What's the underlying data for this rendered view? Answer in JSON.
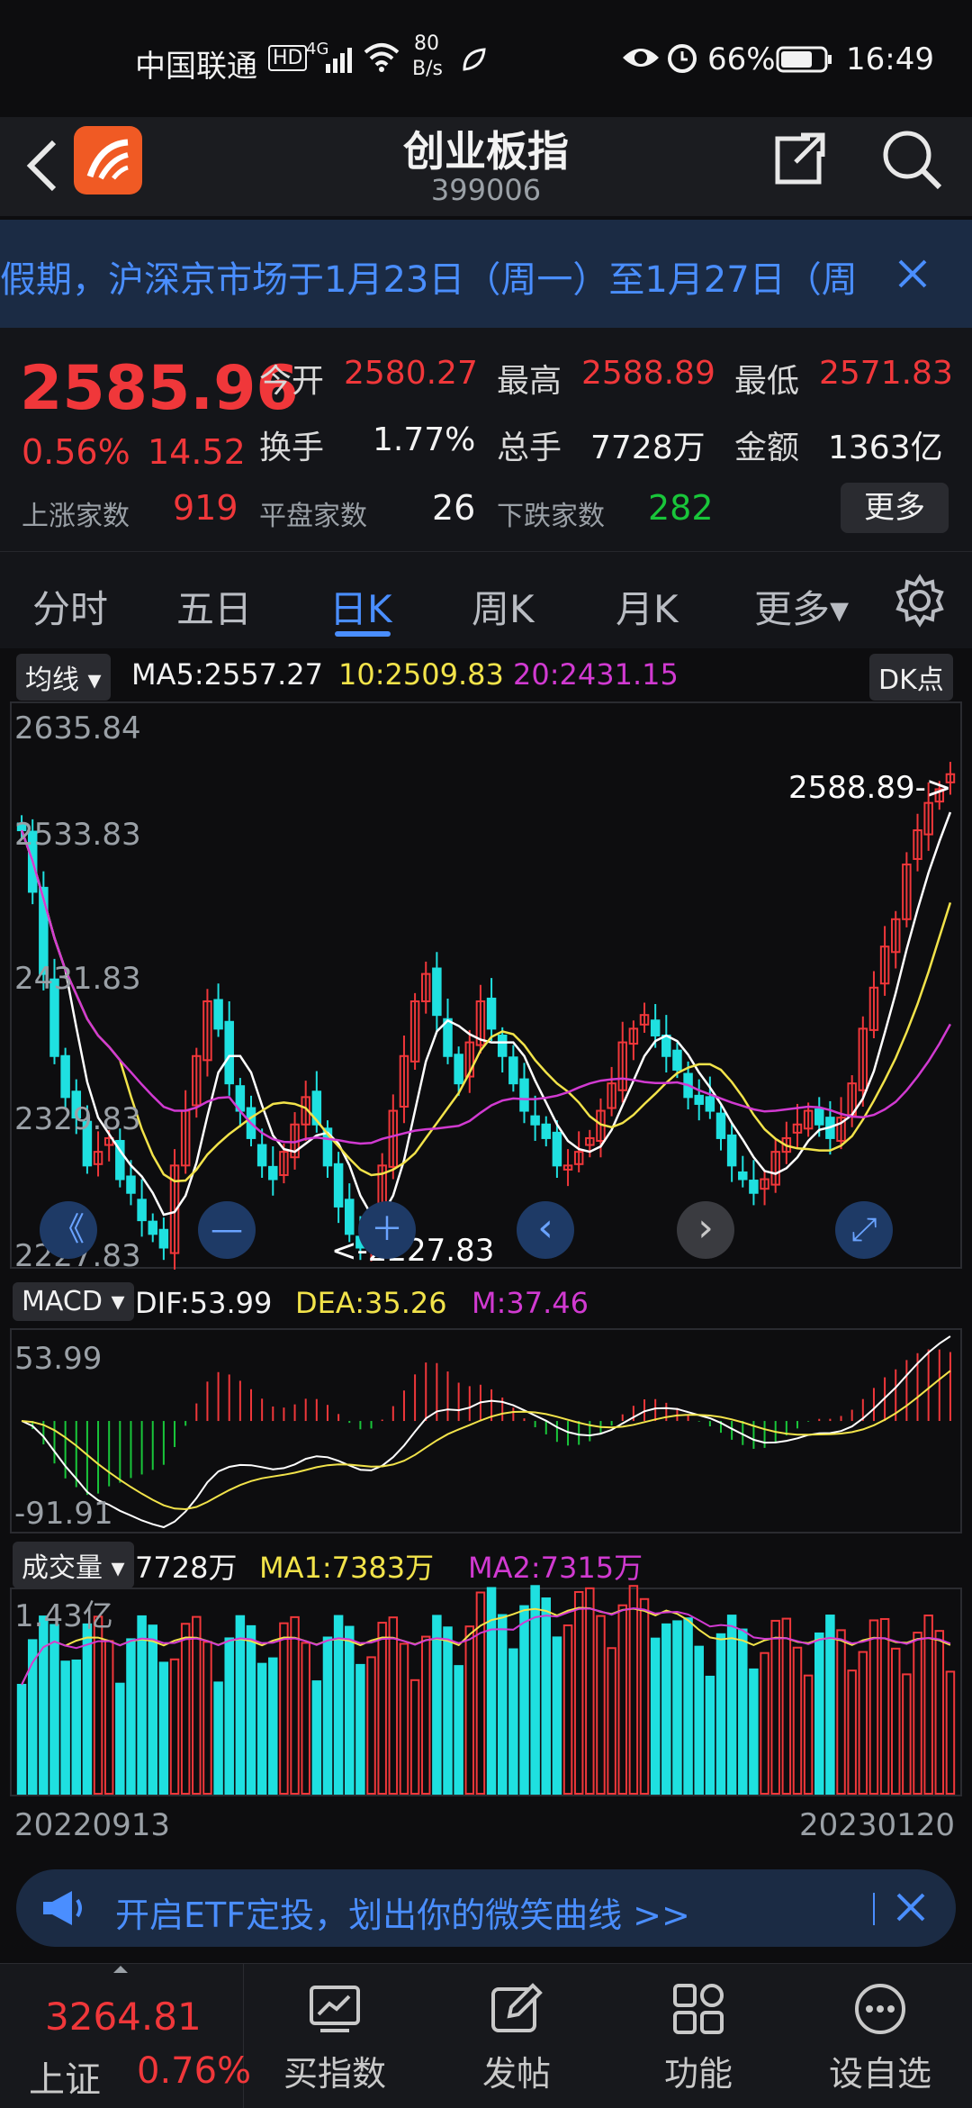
{
  "status_bar": {
    "carrier": "中国联通",
    "hd": "HD",
    "net_type": "4G",
    "speed_top": "80",
    "speed_bottom": "B/s",
    "battery": "66%",
    "time": "16:49"
  },
  "header": {
    "title": "创业板指",
    "code": "399006"
  },
  "notice": {
    "text": "假期，沪深京市场于1月23日（周一）至1月27日（周"
  },
  "quote": {
    "price": "2585.96",
    "change_pct": "0.56%",
    "change": "14.52",
    "open_label": "今开",
    "open": "2580.27",
    "high_label": "最高",
    "high": "2588.89",
    "low_label": "最低",
    "low": "2571.83",
    "turnover_label": "换手",
    "turnover": "1.77%",
    "volume_label": "总手",
    "volume": "7728万",
    "amount_label": "金额",
    "amount": "1363亿",
    "up_label": "上涨家数",
    "up": "919",
    "flat_label": "平盘家数",
    "flat": "26",
    "down_label": "下跌家数",
    "down": "282",
    "more_button": "更多"
  },
  "tabs": [
    "分时",
    "五日",
    "日K",
    "周K",
    "月K",
    "更多▾"
  ],
  "active_tab": 2,
  "ma_legend": {
    "dropdown": "均线",
    "ma5": "MA5:2557.27",
    "ma10": "10:2509.83",
    "ma20": "20:2431.15",
    "dk_button": "DK点"
  },
  "macd_legend": {
    "dropdown": "MACD",
    "dif": "DIF:53.99",
    "dea": "DEA:35.26",
    "m": "M:37.46"
  },
  "vol_legend": {
    "dropdown": "成交量",
    "vol": "7728万",
    "ma1": "MA1:7383万",
    "ma2": "MA2:7315万"
  },
  "chart_data": [
    {
      "type": "candlestick",
      "y_ticks": [
        "2635.84",
        "2533.83",
        "2431.83",
        "2329.83",
        "2227.83"
      ],
      "ylim": [
        2227.83,
        2635.84
      ],
      "annotation_high": "2588.89->",
      "annotation_low": "<-2227.83",
      "colors": {
        "up": "#f0373a",
        "down": "#1fe0e0",
        "ma5": "#ffffff",
        "ma10": "#f2e34a",
        "ma20": "#d13ad1"
      },
      "close": [
        2545,
        2500,
        2440,
        2380,
        2350,
        2335,
        2300,
        2310,
        2320,
        2290,
        2280,
        2260,
        2250,
        2240,
        2300,
        2340,
        2380,
        2420,
        2400,
        2360,
        2340,
        2320,
        2300,
        2290,
        2310,
        2330,
        2350,
        2330,
        2300,
        2270,
        2250,
        2240,
        2260,
        2300,
        2340,
        2380,
        2420,
        2440,
        2410,
        2380,
        2360,
        2390,
        2420,
        2400,
        2380,
        2360,
        2340,
        2330,
        2320,
        2300,
        2300,
        2310,
        2320,
        2340,
        2360,
        2390,
        2400,
        2410,
        2395,
        2380,
        2370,
        2350,
        2345,
        2340,
        2320,
        2300,
        2290,
        2280,
        2290,
        2310,
        2320,
        2330,
        2340,
        2330,
        2320,
        2335,
        2360,
        2400,
        2430,
        2460,
        2480,
        2520,
        2545,
        2565,
        2575,
        2586
      ],
      "macd_ticks": [
        "53.99",
        "-91.91"
      ],
      "vol_tick": "1.43亿",
      "date_start": "20220913",
      "date_end": "20230120"
    }
  ],
  "float_controls": [
    "《",
    "—",
    "＋",
    "‹",
    "›",
    "⤢"
  ],
  "ad_banner": {
    "text": "开启ETF定投，划出你的微笑曲线 >>"
  },
  "bottom_nav": {
    "index_value": "3264.81",
    "index_name": "上证",
    "index_pct": "0.76%",
    "items": [
      "买指数",
      "发帖",
      "功能",
      "设自选"
    ]
  }
}
